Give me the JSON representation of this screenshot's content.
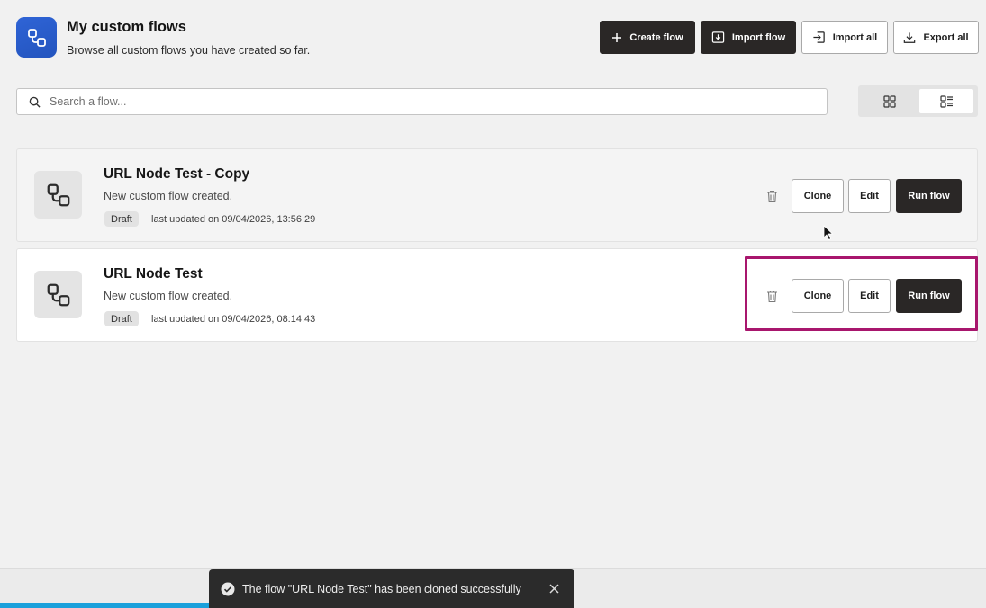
{
  "header": {
    "title": "My custom flows",
    "subtitle": "Browse all custom flows you have created so far.",
    "app_icon": "flow-nodes-icon"
  },
  "toolbar": {
    "create_label": "Create flow",
    "import_label": "Import flow",
    "import_all_label": "Import all",
    "export_all_label": "Export all"
  },
  "search": {
    "placeholder": "Search a flow...",
    "value": ""
  },
  "view_toggle": {
    "selected": "list",
    "options": [
      "grid",
      "list"
    ]
  },
  "flows": [
    {
      "title": "URL Node Test - Copy",
      "description": "New custom flow created.",
      "status": "Draft",
      "updated": "last updated on 09/04/2026, 13:56:29",
      "clone_label": "Clone",
      "edit_label": "Edit",
      "run_label": "Run flow"
    },
    {
      "title": "URL Node Test",
      "description": "New custom flow created.",
      "status": "Draft",
      "updated": "last updated on 09/04/2026, 08:14:43",
      "clone_label": "Clone",
      "edit_label": "Edit",
      "run_label": "Run flow"
    }
  ],
  "toast": {
    "message": "The flow \"URL Node Test\" has been cloned successfully",
    "icon": "check-circle-icon"
  },
  "colors": {
    "primary_button": "#2a2726",
    "app_icon": "#2f64d6",
    "highlight": "#a8166d",
    "progress": "#1aa0db",
    "toast_bg": "#2b2b2b"
  }
}
